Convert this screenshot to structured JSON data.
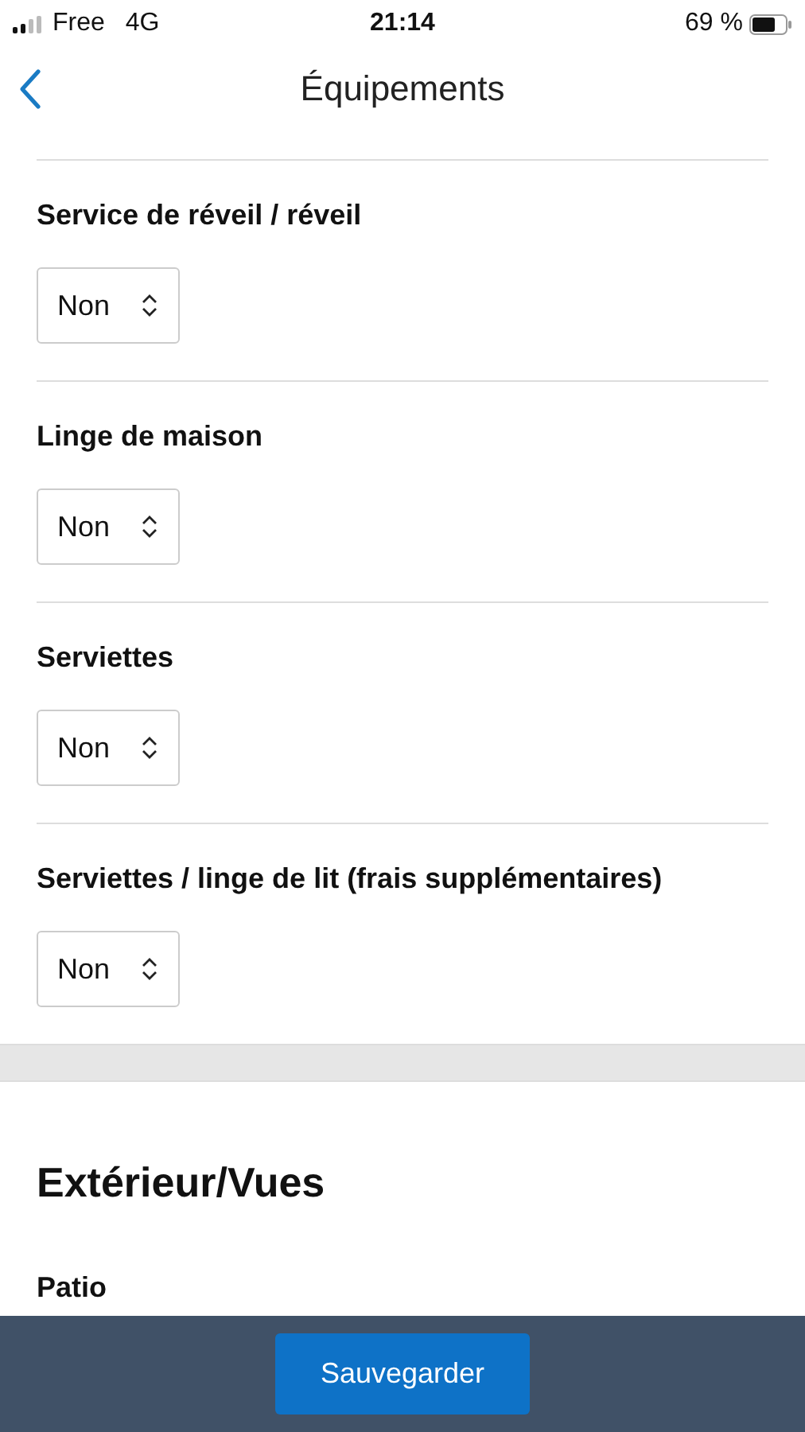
{
  "status_bar": {
    "carrier": "Free",
    "network": "4G",
    "time": "21:14",
    "battery": "69 %"
  },
  "header": {
    "title": "Équipements"
  },
  "fields": [
    {
      "label": "Service de réveil / réveil",
      "value": "Non"
    },
    {
      "label": "Linge de maison",
      "value": "Non"
    },
    {
      "label": "Serviettes",
      "value": "Non"
    },
    {
      "label": "Serviettes / linge de lit (frais supplémentaires)",
      "value": "Non"
    }
  ],
  "next_section": {
    "title": "Extérieur/Vues",
    "fields": [
      {
        "label": "Patio"
      }
    ]
  },
  "save_button": "Sauvegarder"
}
